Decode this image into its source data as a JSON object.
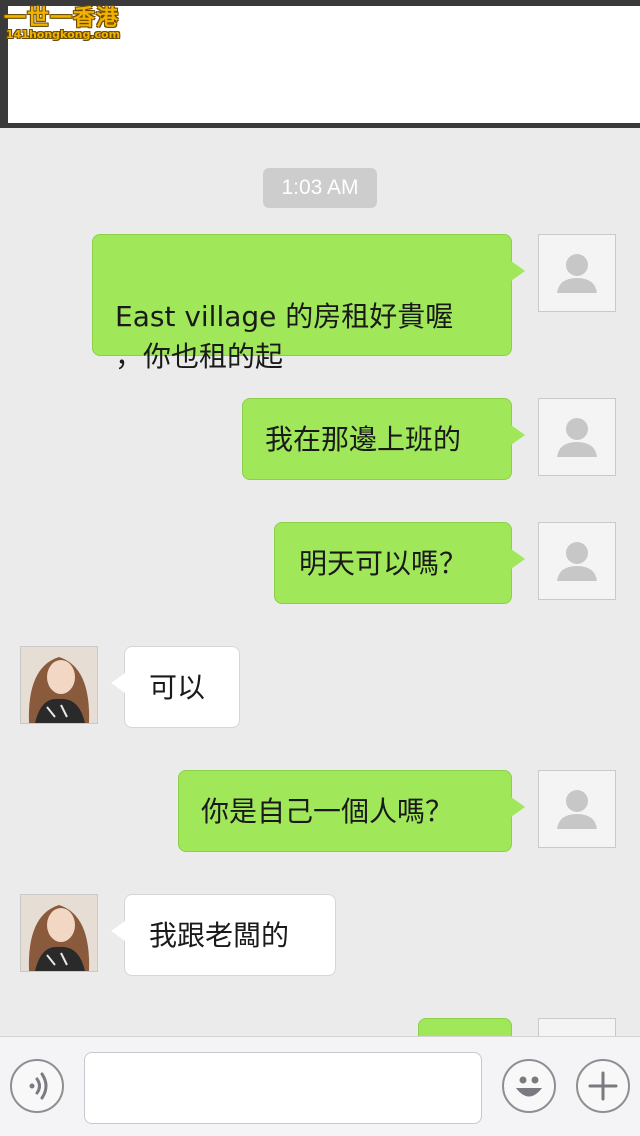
{
  "watermark": {
    "title": "一世一香港",
    "url": "141hongkong.com"
  },
  "timestamp": "1:03 AM",
  "messages": [
    {
      "side": "out",
      "text": "East village 的房租好貴喔\n，你也租的起"
    },
    {
      "side": "out",
      "text": "我在那邊上班的"
    },
    {
      "side": "out",
      "text": "明天可以嗎？"
    },
    {
      "side": "in",
      "text": "可以"
    },
    {
      "side": "out",
      "text": "你是自己一個人嗎？"
    },
    {
      "side": "in",
      "text": "我跟老闆的"
    },
    {
      "side": "out",
      "text": ""
    }
  ],
  "input_bar": {
    "voice_icon": "voice-wave-icon",
    "emoji_icon": "smiley-icon",
    "plus_icon": "plus-icon",
    "input_value": "",
    "input_placeholder": ""
  },
  "colors": {
    "outgoing_bubble": "#a0e75a",
    "incoming_bubble": "#ffffff",
    "background": "#ebebeb",
    "timestamp_bg": "#cdcdcd"
  }
}
